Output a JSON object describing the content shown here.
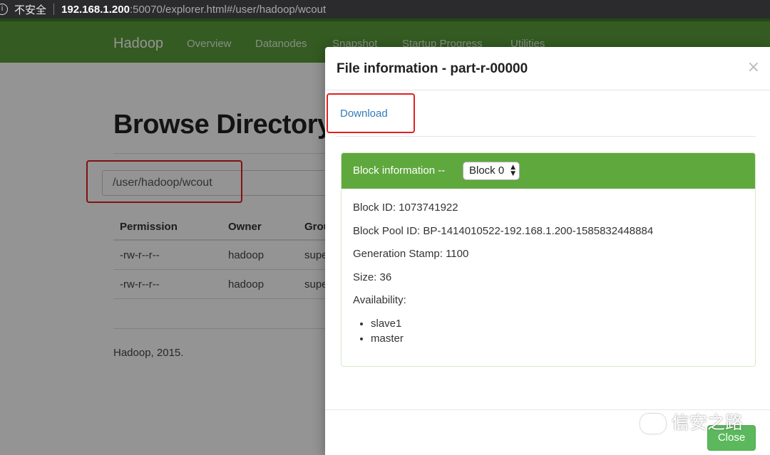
{
  "browser": {
    "info_icon": "info-icon",
    "insecure_label": "不安全",
    "url_host": "192.168.1.200",
    "url_rest": ":50070/explorer.html#/user/hadoop/wcout"
  },
  "navbar": {
    "brand": "Hadoop",
    "items": [
      "Overview",
      "Datanodes",
      "Snapshot",
      "Startup Progress",
      "Utilities"
    ],
    "color": "#5a9e3b"
  },
  "page": {
    "title": "Browse Directory",
    "path": "/user/hadoop/wcout",
    "table": {
      "headers": [
        "Permission",
        "Owner",
        "Group"
      ],
      "rows": [
        [
          "-rw-r--r--",
          "hadoop",
          "supergroup"
        ],
        [
          "-rw-r--r--",
          "hadoop",
          "supergroup"
        ]
      ]
    },
    "footer": "Hadoop, 2015."
  },
  "modal": {
    "title": "File information - part-r-00000",
    "close_symbol": "×",
    "download": "Download",
    "block_label": "Block information --",
    "block_select": "Block 0",
    "details": {
      "block_id": "Block ID: 1073741922",
      "block_pool_id": "Block Pool ID: BP-1414010522-192.168.1.200-1585832448884",
      "generation_stamp": "Generation Stamp: 1100",
      "size": "Size: 36",
      "availability": "Availability:"
    },
    "nodes": [
      "slave1",
      "master"
    ],
    "close_button": "Close",
    "accent": "#5fa83d"
  },
  "watermark": "信安之路"
}
